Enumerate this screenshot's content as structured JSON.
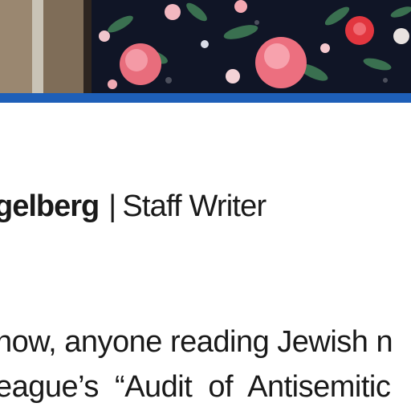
{
  "hero": {
    "icon": "floral-painting-image"
  },
  "colors": {
    "accent_bar": "#1e5fb8",
    "text": "#1a1a1a",
    "background": "#ffffff"
  },
  "byline": {
    "author_name": "gelberg",
    "separator": "|",
    "role": "Staff Writer"
  },
  "article": {
    "line1": "now, anyone reading Jewish n",
    "line2": "eague’s  “Audit  of  Antisemitic"
  }
}
